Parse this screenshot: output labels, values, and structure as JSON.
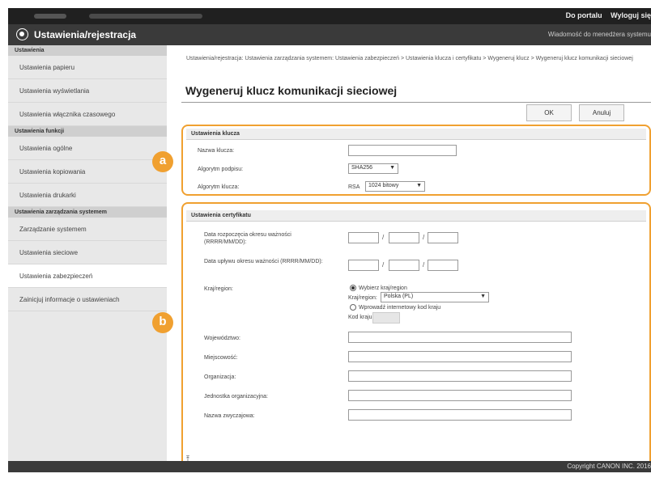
{
  "header": {
    "links": [
      "Do portalu",
      "Wyloguj się"
    ],
    "app_title": "Ustawienia/rejestracja",
    "message": "Wiadomość do menedżera systemu"
  },
  "sidebar": {
    "sections": [
      {
        "heading": "Ustawienia",
        "items": [
          "Ustawienia papieru",
          "Ustawienia wyświetlania",
          "Ustawienia włącznika czasowego"
        ]
      },
      {
        "heading": "Ustawienia funkcji",
        "items": [
          "Ustawienia ogólne",
          "Ustawienia kopiowania",
          "Ustawienia drukarki"
        ]
      },
      {
        "heading": "Ustawienia zarządzania systemem",
        "items": [
          "Zarządzanie systemem",
          "Ustawienia sieciowe",
          "Ustawienia zabezpieczeń",
          "Zainicjuj informacje o ustawieniach"
        ]
      }
    ],
    "active_item": "Ustawienia zabezpieczeń"
  },
  "main": {
    "breadcrumb": "Ustawienia/rejestracja: Ustawienia zarządzania systemem: Ustawienia zabezpieczeń > Ustawienia klucza i certyfikatu > Wygeneruj klucz > Wygeneruj klucz komunikacji sieciowej",
    "title": "Wygeneruj klucz komunikacji sieciowej",
    "ok_label": "OK",
    "cancel_label": "Anuluj",
    "key_section": {
      "heading": "Ustawienia klucza",
      "key_name_label": "Nazwa klucza:",
      "key_name_value": "",
      "signature_algorithm_label": "Algorytm podpisu:",
      "signature_algorithm_value": "SHA256",
      "key_algorithm_label": "Algorytm klucza:",
      "key_algorithm_type": "RSA",
      "key_length_value": "1024 bitowy"
    },
    "cert_section": {
      "heading": "Ustawienia certyfikatu",
      "start_date_label": "Data rozpoczęcia okresu ważności (RRRR/MM/DD):",
      "end_date_label": "Data upływu okresu ważności (RRRR/MM/DD):",
      "date_separator": "/",
      "country_label": "Kraj/region:",
      "choose_country_label": "Wybierz kraj/region",
      "country_select_label": "Kraj/region:",
      "country_select_value": "Polska (PL)",
      "internet_code_label": "Wprowadź internetowy kod kraju",
      "country_code_label": "Kod kraju:",
      "province_label": "Województwo:",
      "city_label": "Miejscowość:",
      "organization_label": "Organizacja:",
      "org_unit_label": "Jednostka organizacyjna:",
      "common_name_label": "Nazwa zwyczajowa:"
    },
    "callouts": [
      "a",
      "b"
    ],
    "top_link": "⤒"
  },
  "footer": {
    "copyright": "Copyright CANON INC. 2016"
  },
  "colors": {
    "highlight": "#f0a030",
    "header_bg": "#3a3a3a",
    "topbar_bg": "#202020"
  }
}
